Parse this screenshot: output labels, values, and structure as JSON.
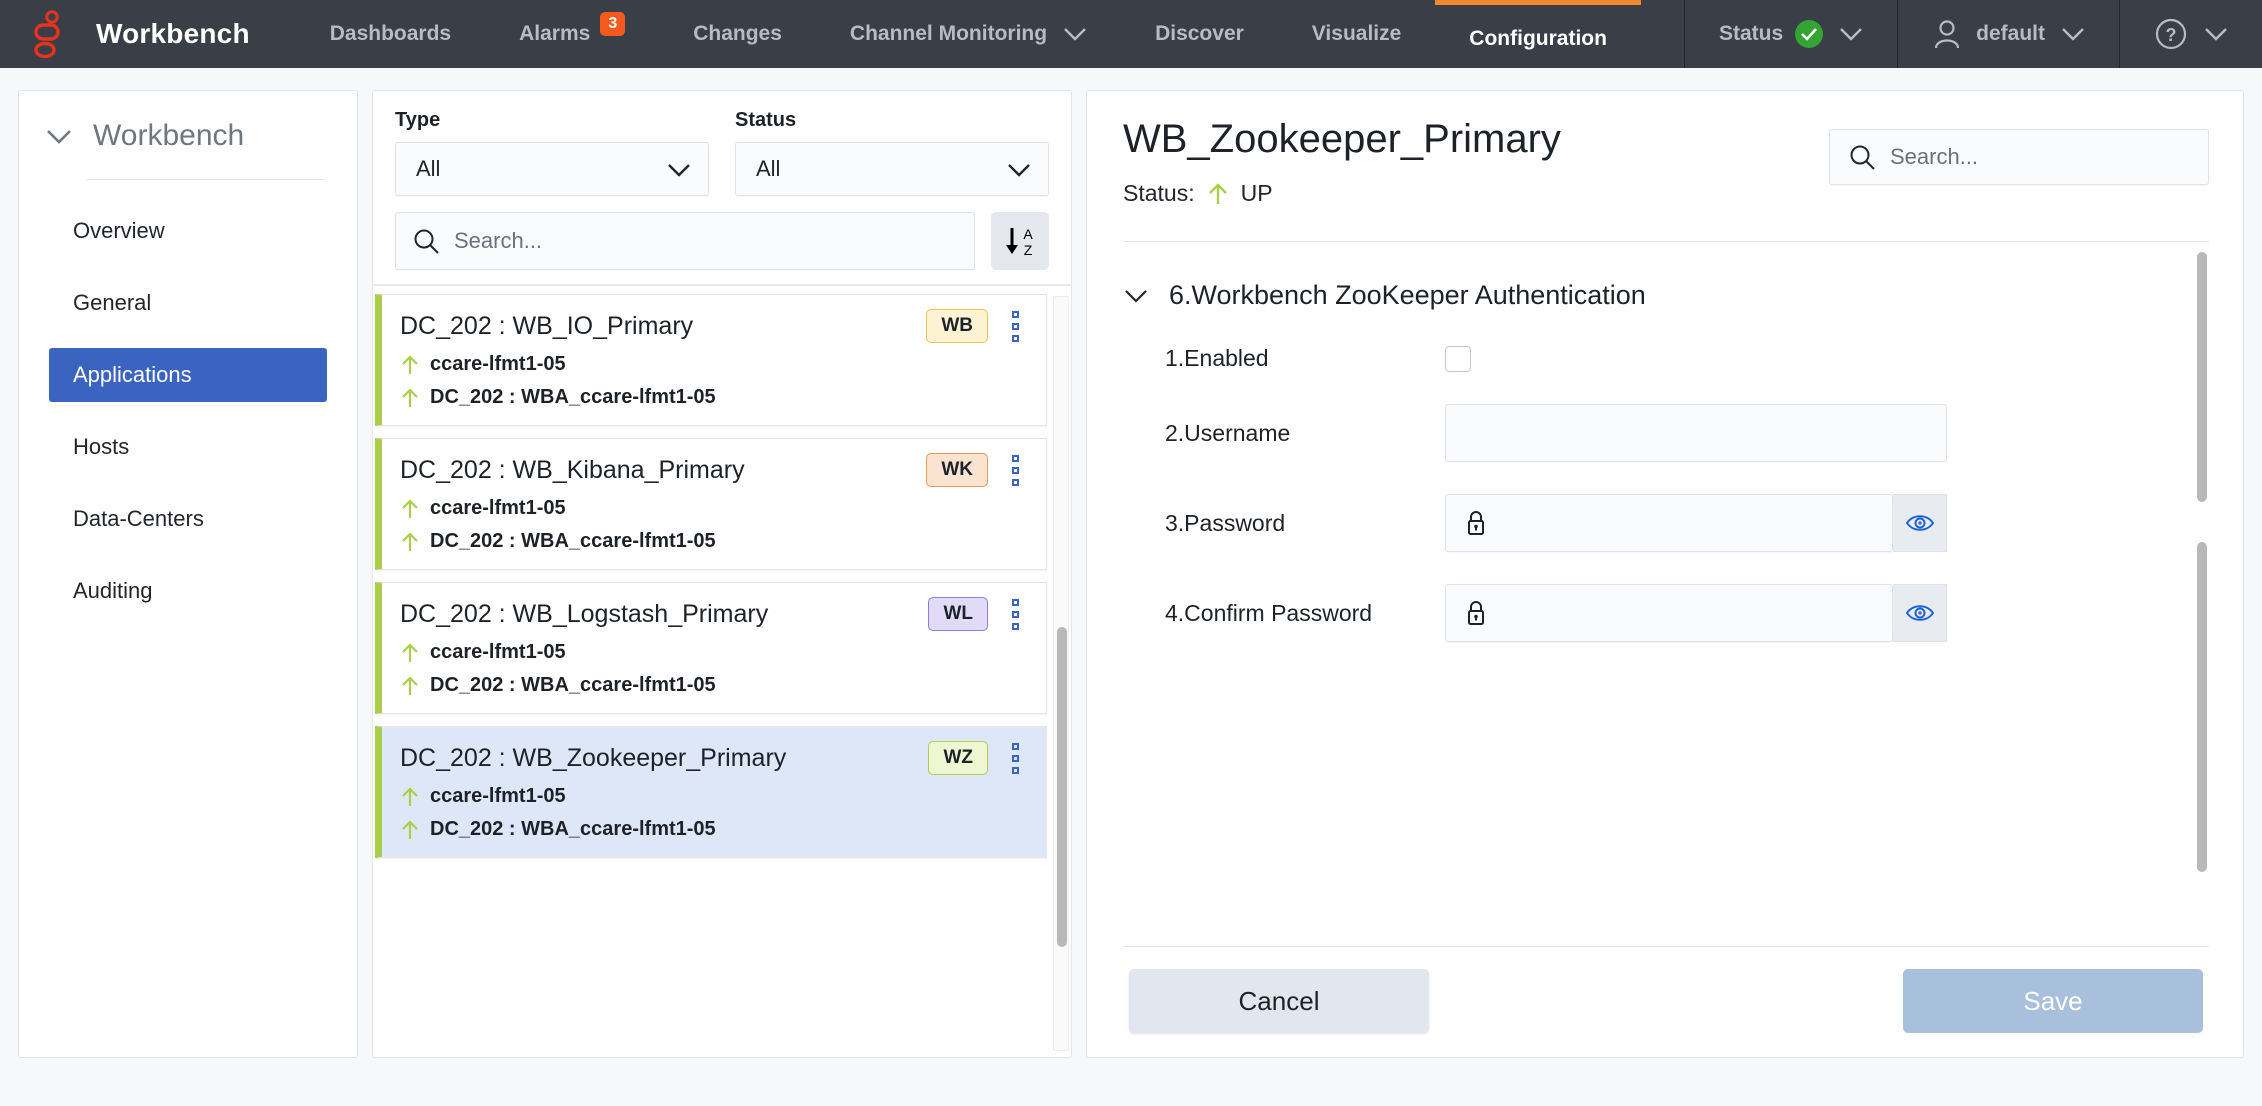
{
  "topnav": {
    "brand": "Workbench",
    "logo_icon": "chain-logo-icon",
    "items": [
      {
        "label": "Dashboards",
        "icon": null,
        "badge": null,
        "active": false
      },
      {
        "label": "Alarms",
        "icon": null,
        "badge": "3",
        "active": false
      },
      {
        "label": "Changes",
        "icon": null,
        "badge": null,
        "active": false
      },
      {
        "label": "Channel Monitoring",
        "icon": "chevron-down-icon",
        "badge": null,
        "active": false
      },
      {
        "label": "Discover",
        "icon": null,
        "badge": null,
        "active": false
      },
      {
        "label": "Visualize",
        "icon": null,
        "badge": null,
        "active": false
      },
      {
        "label": "Configuration",
        "icon": null,
        "badge": null,
        "active": true
      }
    ],
    "status": {
      "label": "Status",
      "state_icon": "green-check-icon",
      "chevron": "chevron-down-icon"
    },
    "user": {
      "label": "default",
      "icon": "user-avatar-icon",
      "chevron": "chevron-down-icon"
    },
    "help": {
      "icon": "help-circle-icon",
      "chevron": "chevron-down-icon"
    },
    "accent_active": "#f0892f",
    "alarm_badge_color": "#f4591e",
    "bg": "#3a3f47"
  },
  "sidebar": {
    "title": "Workbench",
    "collapse_icon": "chevron-down-icon",
    "active_color": "#3b63c0",
    "items": [
      {
        "label": "Overview",
        "active": false
      },
      {
        "label": "General",
        "active": false
      },
      {
        "label": "Applications",
        "active": true
      },
      {
        "label": "Hosts",
        "active": false
      },
      {
        "label": "Data-Centers",
        "active": false
      },
      {
        "label": "Auditing",
        "active": false
      }
    ]
  },
  "filters": {
    "type": {
      "label": "Type",
      "value": "All",
      "chevron": "chevron-down-icon"
    },
    "status": {
      "label": "Status",
      "value": "All",
      "chevron": "chevron-down-icon"
    },
    "search": {
      "placeholder": "Search...",
      "value": "",
      "icon": "search-icon"
    },
    "sort": {
      "icon": "sort-a-z-icon",
      "label": "A-Z"
    }
  },
  "app_list": {
    "status_arrow_icon": "arrow-up-icon",
    "status_arrow_color": "#aacd4a",
    "kebab_icon": "kebab-menu-icon",
    "cards": [
      {
        "title": "DC_202 : WB_IO_Primary",
        "badge": "WB",
        "badge_bg": "#fdf3d3",
        "badge_border": "#e8c55a",
        "host": "ccare-lfmt1-05",
        "agent": "DC_202 : WBA_ccare-lfmt1-05",
        "selected": false
      },
      {
        "title": "DC_202 : WB_Kibana_Primary",
        "badge": "WK",
        "badge_bg": "#fbe3d0",
        "badge_border": "#e09a5e",
        "host": "ccare-lfmt1-05",
        "agent": "DC_202 : WBA_ccare-lfmt1-05",
        "selected": false
      },
      {
        "title": "DC_202 : WB_Logstash_Primary",
        "badge": "WL",
        "badge_bg": "#e2dbf7",
        "badge_border": "#8e7ddb",
        "host": "ccare-lfmt1-05",
        "agent": "DC_202 : WBA_ccare-lfmt1-05",
        "selected": false
      },
      {
        "title": "DC_202 : WB_Zookeeper_Primary",
        "badge": "WZ",
        "badge_bg": "#eef6d2",
        "badge_border": "#b2cb59",
        "host": "ccare-lfmt1-05",
        "agent": "DC_202 : WBA_ccare-lfmt1-05",
        "selected": true
      }
    ]
  },
  "detail": {
    "title": "WB_Zookeeper_Primary",
    "status_label": "Status:",
    "status_value": "UP",
    "status_icon": "arrow-up-icon",
    "search": {
      "placeholder": "Search...",
      "value": "",
      "icon": "search-icon"
    },
    "section": {
      "title": "6.Workbench ZooKeeper Authentication",
      "collapse_icon": "chevron-down-icon"
    },
    "fields": [
      {
        "label": "1.Enabled",
        "type": "checkbox",
        "checked": false,
        "value": ""
      },
      {
        "label": "2.Username",
        "type": "text",
        "value": "",
        "placeholder": ""
      },
      {
        "label": "3.Password",
        "type": "password",
        "value": "",
        "placeholder": "",
        "lock_icon": "lock-icon",
        "reveal_icon": "eye-icon"
      },
      {
        "label": "4.Confirm Password",
        "type": "password",
        "value": "",
        "placeholder": "",
        "lock_icon": "lock-icon",
        "reveal_icon": "eye-icon"
      }
    ],
    "footer": {
      "cancel_label": "Cancel",
      "save_label": "Save"
    }
  }
}
